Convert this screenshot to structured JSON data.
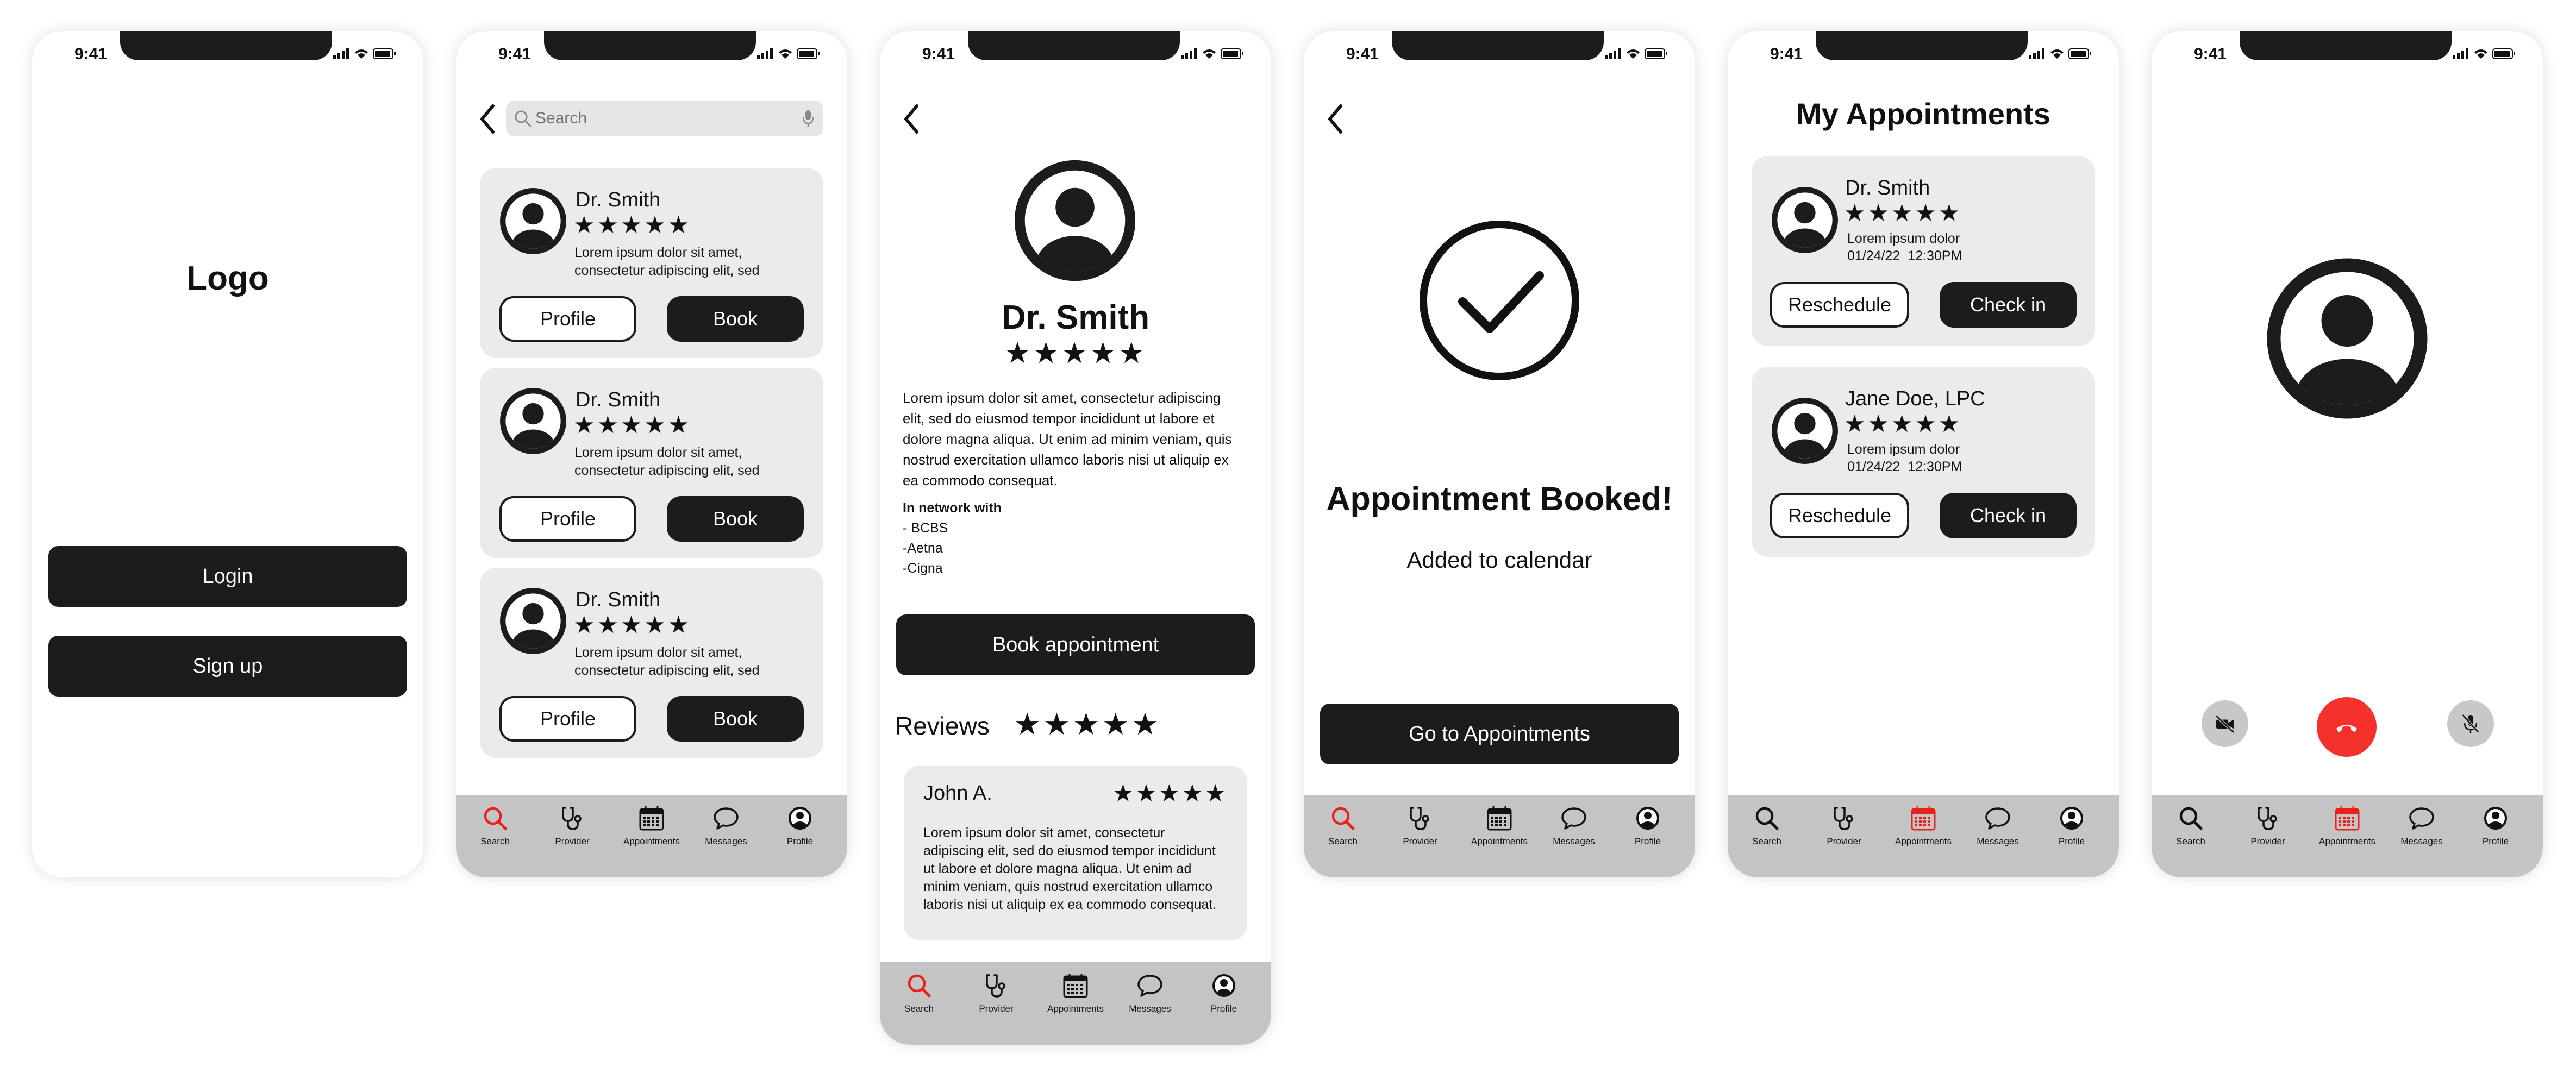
{
  "status": {
    "time": "9:41"
  },
  "tabs": [
    "Search",
    "Provider",
    "Appointments",
    "Messages",
    "Profile"
  ],
  "colors": {
    "dark": "#1c1c1c",
    "accent_red": "#e8211c",
    "card_bg": "#ebebeb",
    "tabbar_bg": "#c4c4c4",
    "end_call": "#f5312b"
  },
  "login_screen": {
    "logo": "Logo",
    "login_label": "Login",
    "signup_label": "Sign up"
  },
  "search_screen": {
    "search_placeholder": "Search",
    "providers": [
      {
        "name": "Dr. Smith",
        "rating": "★★★★★",
        "blurb_1": "Lorem ipsum dolor sit amet,",
        "blurb_2": "consectetur adipiscing elit, sed",
        "profile_label": "Profile",
        "book_label": "Book"
      },
      {
        "name": "Dr. Smith",
        "rating": "★★★★★",
        "blurb_1": "Lorem ipsum dolor sit amet,",
        "blurb_2": "consectetur adipiscing elit, sed",
        "profile_label": "Profile",
        "book_label": "Book"
      },
      {
        "name": "Dr. Smith",
        "rating": "★★★★★",
        "blurb_1": "Lorem ipsum dolor sit amet,",
        "blurb_2": "consectetur adipiscing elit, sed",
        "profile_label": "Profile",
        "book_label": "Book"
      }
    ]
  },
  "profile_screen": {
    "name": "Dr. Smith",
    "rating": "★★★★★",
    "bio": [
      "Lorem ipsum dolor sit amet, consectetur adipiscing",
      "elit, sed do eiusmod tempor incididunt ut labore et",
      "dolore magna aliqua. Ut enim ad minim veniam, quis",
      "nostrud exercitation ullamco laboris nisi ut aliquip ex",
      "ea commodo consequat."
    ],
    "network_heading": "In network with",
    "networks": [
      "- BCBS",
      "-Aetna",
      "-Cigna"
    ],
    "book_label": "Book appointment",
    "reviews_heading": "Reviews",
    "reviews_rating": "★★★★★",
    "review": {
      "author": "John A.",
      "rating": "★★★★★",
      "text": [
        "Lorem ipsum dolor sit amet, consectetur",
        "adipiscing elit, sed do eiusmod tempor incididunt",
        "ut labore et dolore magna aliqua. Ut enim ad",
        "minim veniam, quis nostrud exercitation ullamco",
        "laboris nisi ut aliquip ex ea commodo consequat."
      ]
    }
  },
  "booked_screen": {
    "title": "Appointment Booked!",
    "subtitle": "Added to calendar",
    "cta": "Go to Appointments"
  },
  "appointments_screen": {
    "title": "My Appointments",
    "items": [
      {
        "name": "Dr. Smith",
        "rating": "★★★★★",
        "note": "Lorem ipsum dolor",
        "datetime": "01/24/22  12:30PM",
        "reschedule_label": "Reschedule",
        "checkin_label": "Check in"
      },
      {
        "name": "Jane Doe, LPC",
        "rating": "★★★★★",
        "note": "Lorem ipsum dolor",
        "datetime": "01/24/22  12:30PM",
        "reschedule_label": "Reschedule",
        "checkin_label": "Check in"
      }
    ]
  }
}
